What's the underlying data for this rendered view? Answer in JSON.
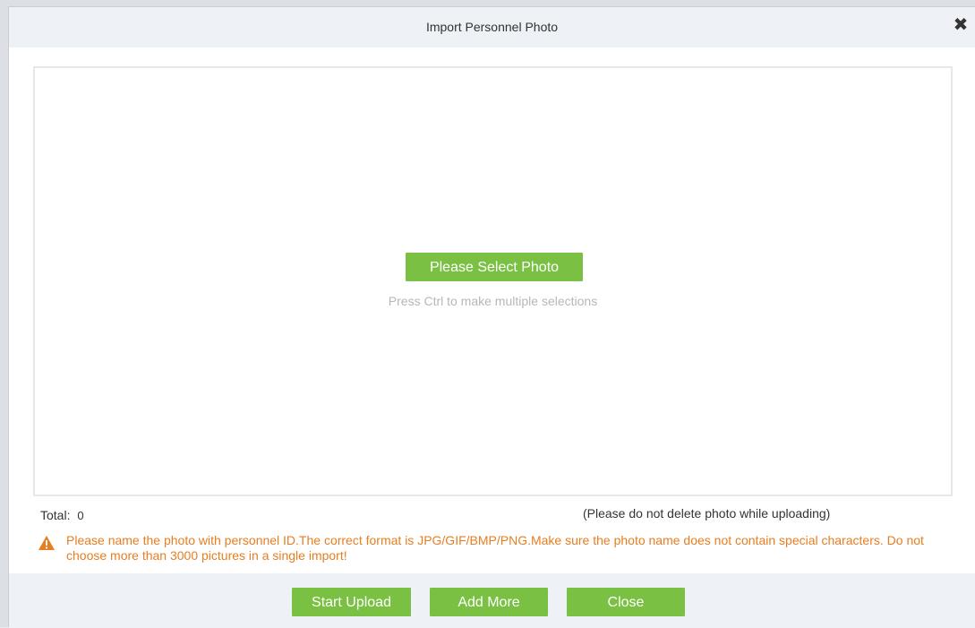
{
  "dialog": {
    "title": "Import Personnel Photo",
    "close_glyph": "✕"
  },
  "upload_area": {
    "select_button_label": "Please Select Photo",
    "hint": "Press Ctrl to make multiple selections"
  },
  "status": {
    "total_label": "Total:",
    "total_value": "0",
    "uploading_note": "(Please do not delete photo while uploading)"
  },
  "warning": {
    "icon": "warning-triangle-icon",
    "text": "Please name the photo with personnel ID.The correct format is JPG/GIF/BMP/PNG.Make sure the photo name does not contain special characters. Do not choose more than 3000 pictures in a single import!"
  },
  "footer": {
    "start_upload_label": "Start Upload",
    "add_more_label": "Add More",
    "close_label": "Close"
  },
  "colors": {
    "accent_green": "#7ac143",
    "warning_orange": "#e67e22",
    "header_bg": "#eef1f5"
  }
}
